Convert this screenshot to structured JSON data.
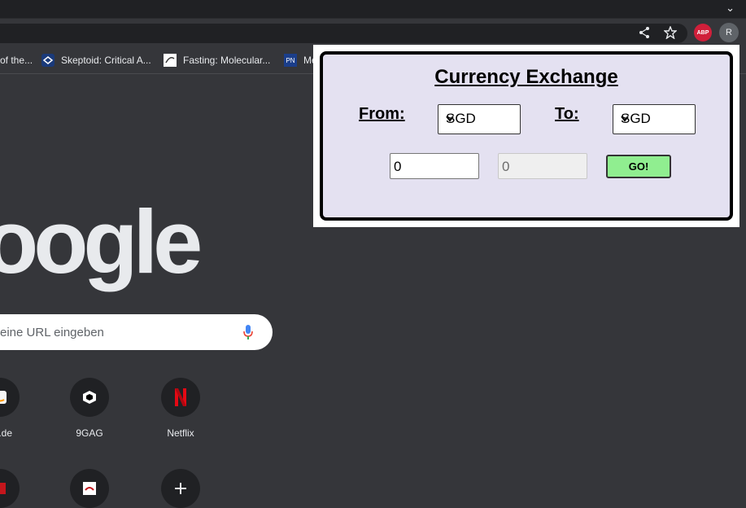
{
  "bookmarks": [
    {
      "label": "of the..."
    },
    {
      "label": "Skeptoid: Critical A..."
    },
    {
      "label": "Fasting: Molecular..."
    },
    {
      "label": "Me"
    }
  ],
  "profile_initial": "R",
  "abp_label": "ABP",
  "ntp": {
    "search_placeholder": "eine URL eingeben",
    "shortcuts": [
      {
        "label": "on.de"
      },
      {
        "label": "9GAG"
      },
      {
        "label": "Netflix"
      }
    ],
    "logo_text": "oogle"
  },
  "popup": {
    "title": "Currency Exchange",
    "from_label": "From:",
    "to_label": "To:",
    "from_currency": "SGD",
    "to_currency": "SGD",
    "amount_value": "0",
    "result_value": "0",
    "go_label": "GO!"
  },
  "colors": {
    "popup_bg": "#e4e1f1",
    "go_button": "#90ee90",
    "abp_red": "#d01f3a"
  }
}
